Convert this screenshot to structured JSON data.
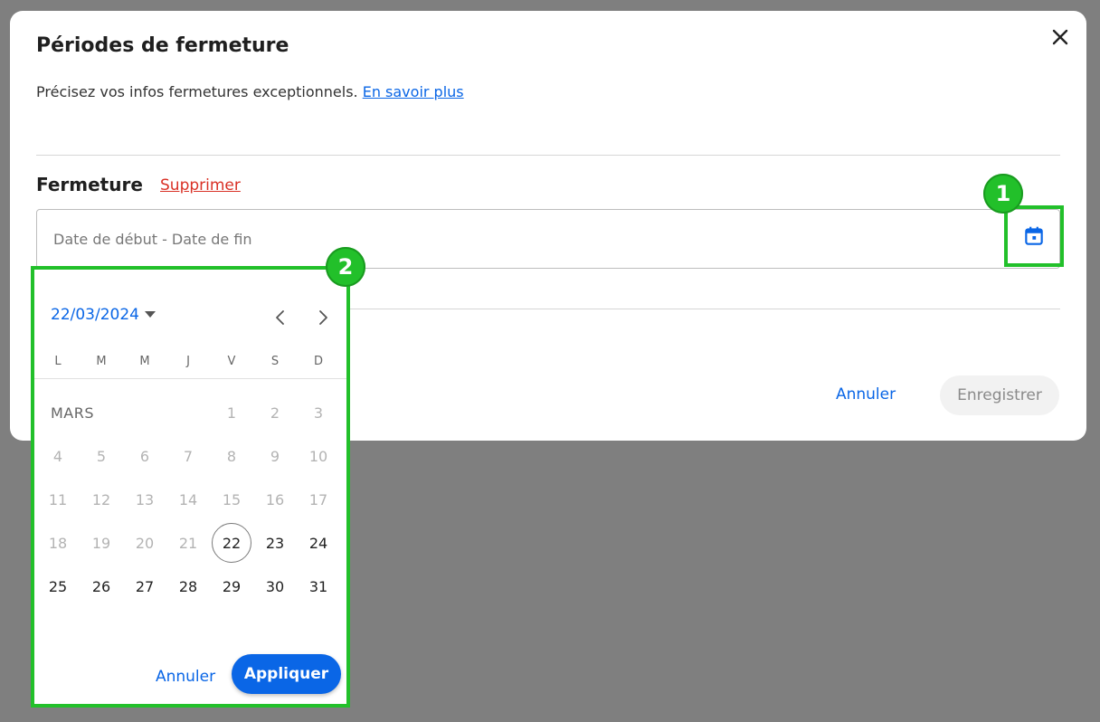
{
  "colors": {
    "accent": "#0a66e6",
    "danger": "#d93025",
    "highlight": "#22c02a",
    "overlay": "#7f7f7f"
  },
  "modal": {
    "title": "Périodes de fermeture",
    "close_icon": "close-icon",
    "description": "Précisez vos infos fermetures exceptionnels.",
    "learn_more": "En savoir plus",
    "section_title": "Fermeture",
    "delete_label": "Supprimer",
    "date_placeholder": "Date de début - Date de fin",
    "calendar_icon": "calendar-icon",
    "cancel_label": "Annuler",
    "save_label": "Enregistrer"
  },
  "markers": [
    "1",
    "2"
  ],
  "picker": {
    "selected_date": "22/03/2024",
    "weekdays": [
      "L",
      "M",
      "M",
      "J",
      "V",
      "S",
      "D"
    ],
    "month_label": "MARS",
    "first_weekday_index": 4,
    "selected_day": 22,
    "min_enabled_day": 22,
    "days": [
      1,
      2,
      3,
      4,
      5,
      6,
      7,
      8,
      9,
      10,
      11,
      12,
      13,
      14,
      15,
      16,
      17,
      18,
      19,
      20,
      21,
      22,
      23,
      24,
      25,
      26,
      27,
      28,
      29,
      30,
      31
    ],
    "cancel_label": "Annuler",
    "apply_label": "Appliquer"
  }
}
